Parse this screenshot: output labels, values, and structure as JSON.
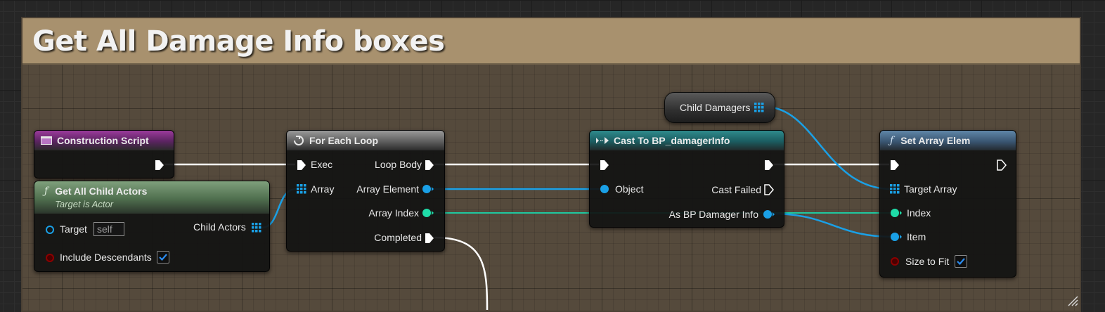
{
  "comment": {
    "title": "Get All Damage Info boxes"
  },
  "colors": {
    "exec": "#ffffff",
    "object_pin": "#1aa0e6",
    "int_pin": "#1fdca8",
    "bool_pin": "#8c0000",
    "comment_header": "#a8916e"
  },
  "nodes": {
    "construction_script": {
      "title": "Construction Script",
      "icon": "construction-script-icon"
    },
    "get_all_child_actors": {
      "title": "Get All Child Actors",
      "subtitle": "Target is Actor",
      "target_label": "Target",
      "target_value": "self",
      "include_descendants_label": "Include Descendants",
      "include_descendants_checked": true,
      "output_label": "Child Actors"
    },
    "for_each_loop": {
      "title": "For Each Loop",
      "exec_in_label": "Exec",
      "array_label": "Array",
      "loop_body_label": "Loop Body",
      "array_element_label": "Array Element",
      "array_index_label": "Array Index",
      "completed_label": "Completed"
    },
    "child_damagers": {
      "label": "Child Damagers"
    },
    "cast": {
      "title": "Cast To BP_damagerInfo",
      "object_label": "Object",
      "cast_failed_label": "Cast Failed",
      "as_label": "As BP Damager Info"
    },
    "set_array_elem": {
      "title": "Set Array Elem",
      "target_array_label": "Target Array",
      "index_label": "Index",
      "item_label": "Item",
      "size_to_fit_label": "Size to Fit",
      "size_to_fit_checked": true
    }
  }
}
